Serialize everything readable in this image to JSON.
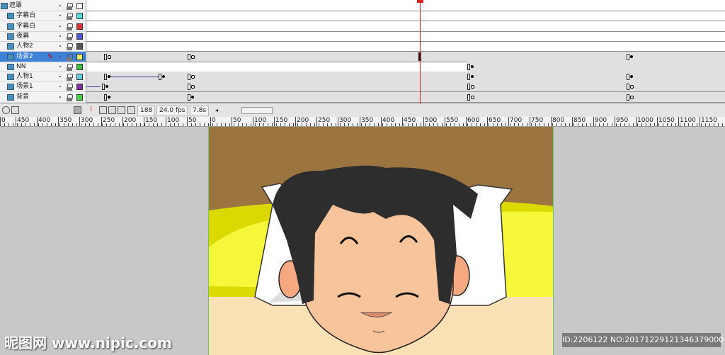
{
  "layers": [
    {
      "name": "遮罩",
      "color": "#ffffff",
      "selected": false
    },
    {
      "name": "字幕白",
      "color": "#55e0e0",
      "selected": false
    },
    {
      "name": "字幕白",
      "color": "#e03030",
      "selected": false
    },
    {
      "name": "夜幕",
      "color": "#4a55d8",
      "selected": false
    },
    {
      "name": "人物2",
      "color": "#555555",
      "selected": false
    },
    {
      "name": "场景2",
      "color": "#f0f070",
      "selected": true
    },
    {
      "name": "NN",
      "color": "#40c040",
      "selected": false
    },
    {
      "name": "人物1",
      "color": "#60d0e0",
      "selected": false
    },
    {
      "name": "场景1",
      "color": "#8030a0",
      "selected": false
    },
    {
      "name": "背景",
      "color": "#40d040",
      "selected": false
    }
  ],
  "timeline_status": {
    "frame": "188",
    "fps": "24.0 fps",
    "time": "7.8s"
  },
  "ruler": {
    "labels": [
      "0",
      "450",
      "400",
      "350",
      "300",
      "250",
      "200",
      "150",
      "100",
      "50",
      "0",
      "50",
      "100",
      "150",
      "200",
      "250",
      "300",
      "350",
      "400",
      "450",
      "500",
      "550",
      "600",
      "650",
      "700",
      "750",
      "800",
      "850",
      "900",
      "950",
      "1000",
      "1050",
      "1100",
      "1150"
    ]
  },
  "watermark": {
    "left": "昵图网 www.nipic.com",
    "right": "ID:2206122 NO:20171229121346379000"
  },
  "colors": {
    "selection": "#3d82d6",
    "playhead": "#dd2222",
    "wall": "#9b7440",
    "bed": "#f2f24a",
    "skin": "#f8c49c",
    "hair": "#2d2d2d"
  }
}
